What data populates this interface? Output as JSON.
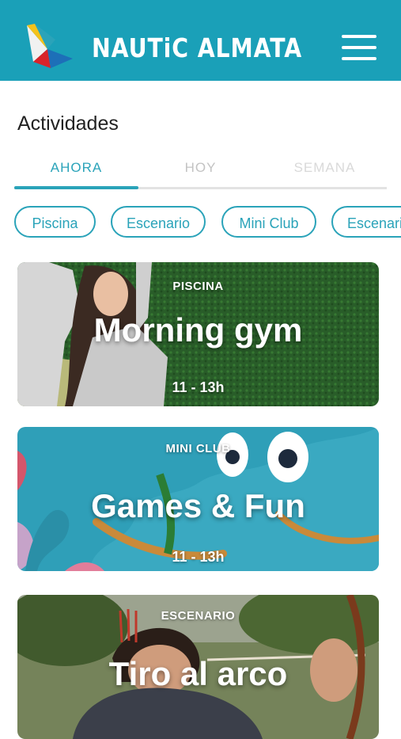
{
  "header": {
    "brand": "NAUTiC ALMATA",
    "logo_icon": "sailboat-logo-icon",
    "menu_icon": "hamburger-menu-icon"
  },
  "section_title": "Actividades",
  "tabs": [
    {
      "label": "AHORA",
      "active": true
    },
    {
      "label": "HOY",
      "active": false
    },
    {
      "label": "SEMANA",
      "active": false
    }
  ],
  "filters": [
    {
      "label": "Piscina"
    },
    {
      "label": "Escenario"
    },
    {
      "label": "Mini Club"
    },
    {
      "label": "Escenario"
    }
  ],
  "activities": [
    {
      "category": "PISCINA",
      "title": "Morning gym",
      "time": "11 - 13h"
    },
    {
      "category": "MINI CLUB",
      "title": "Games & Fun",
      "time": "11 - 13h"
    },
    {
      "category": "ESCENARIO",
      "title": "Tiro al arco",
      "time": ""
    }
  ],
  "colors": {
    "header_bg": "#1aa0b8",
    "accent": "#2aa3b9",
    "inactive_tab": "#c3c3c3"
  }
}
